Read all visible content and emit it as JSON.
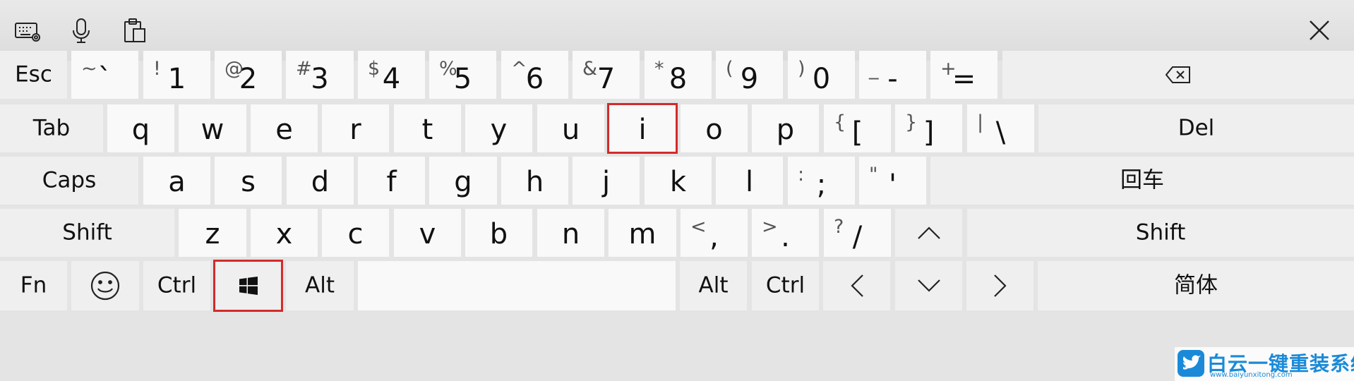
{
  "toolbar": {
    "icons": [
      "keyboard-settings-icon",
      "microphone-icon",
      "clipboard-icon",
      "close-icon"
    ]
  },
  "rows": [
    [
      {
        "name": "esc",
        "label": "Esc",
        "func": true
      },
      {
        "name": "backtick",
        "main": "`",
        "sec": "~"
      },
      {
        "name": "1",
        "main": "1",
        "sec": "!"
      },
      {
        "name": "2",
        "main": "2",
        "sec": "@"
      },
      {
        "name": "3",
        "main": "3",
        "sec": "#"
      },
      {
        "name": "4",
        "main": "4",
        "sec": "$"
      },
      {
        "name": "5",
        "main": "5",
        "sec": "%"
      },
      {
        "name": "6",
        "main": "6",
        "sec": "^"
      },
      {
        "name": "7",
        "main": "7",
        "sec": "&"
      },
      {
        "name": "8",
        "main": "8",
        "sec": "*"
      },
      {
        "name": "9",
        "main": "9",
        "sec": "("
      },
      {
        "name": "0",
        "main": "0",
        "sec": ")"
      },
      {
        "name": "minus",
        "main": "-",
        "sec": "_"
      },
      {
        "name": "equals",
        "main": "=",
        "sec": "+"
      },
      {
        "name": "backspace",
        "icon": "backspace-icon",
        "func": true
      }
    ],
    [
      {
        "name": "tab",
        "label": "Tab",
        "func": true
      },
      {
        "name": "q",
        "main": "q"
      },
      {
        "name": "w",
        "main": "w"
      },
      {
        "name": "e",
        "main": "e"
      },
      {
        "name": "r",
        "main": "r"
      },
      {
        "name": "t",
        "main": "t"
      },
      {
        "name": "y",
        "main": "y"
      },
      {
        "name": "u",
        "main": "u"
      },
      {
        "name": "i",
        "main": "i"
      },
      {
        "name": "o",
        "main": "o"
      },
      {
        "name": "p",
        "main": "p"
      },
      {
        "name": "left-bracket",
        "main": "[",
        "sec": "{"
      },
      {
        "name": "right-bracket",
        "main": "]",
        "sec": "}"
      },
      {
        "name": "backslash",
        "main": "\\",
        "sec": "|"
      },
      {
        "name": "del",
        "label": "Del",
        "func": true
      }
    ],
    [
      {
        "name": "caps",
        "label": "Caps",
        "func": true
      },
      {
        "name": "a",
        "main": "a"
      },
      {
        "name": "s",
        "main": "s"
      },
      {
        "name": "d",
        "main": "d"
      },
      {
        "name": "f",
        "main": "f"
      },
      {
        "name": "g",
        "main": "g"
      },
      {
        "name": "h",
        "main": "h"
      },
      {
        "name": "j",
        "main": "j"
      },
      {
        "name": "k",
        "main": "k"
      },
      {
        "name": "l",
        "main": "l"
      },
      {
        "name": "semicolon",
        "main": ";",
        "sec": ":"
      },
      {
        "name": "quote",
        "main": "'",
        "sec": "\""
      },
      {
        "name": "enter",
        "label": "回车",
        "func": true
      }
    ],
    [
      {
        "name": "shift-left",
        "label": "Shift",
        "func": true
      },
      {
        "name": "z",
        "main": "z"
      },
      {
        "name": "x",
        "main": "x"
      },
      {
        "name": "c",
        "main": "c"
      },
      {
        "name": "v",
        "main": "v"
      },
      {
        "name": "b",
        "main": "b"
      },
      {
        "name": "n",
        "main": "n"
      },
      {
        "name": "m",
        "main": "m"
      },
      {
        "name": "comma",
        "main": ",",
        "sec": "<"
      },
      {
        "name": "period",
        "main": ".",
        "sec": ">"
      },
      {
        "name": "slash",
        "main": "/",
        "sec": "?"
      },
      {
        "name": "up",
        "icon": "arrow-up-icon",
        "func": true
      },
      {
        "name": "shift-right",
        "label": "Shift",
        "func": true
      }
    ],
    [
      {
        "name": "fn",
        "label": "Fn",
        "func": true
      },
      {
        "name": "emoji",
        "icon": "emoji-icon",
        "func": true
      },
      {
        "name": "ctrl-left",
        "label": "Ctrl",
        "func": true
      },
      {
        "name": "windows",
        "icon": "windows-icon",
        "func": true
      },
      {
        "name": "alt-left",
        "label": "Alt",
        "func": true
      },
      {
        "name": "space"
      },
      {
        "name": "alt-right",
        "label": "Alt",
        "func": true
      },
      {
        "name": "ctrl-right",
        "label": "Ctrl",
        "func": true
      },
      {
        "name": "left",
        "icon": "arrow-left-icon",
        "func": true
      },
      {
        "name": "down",
        "icon": "arrow-down-icon",
        "func": true
      },
      {
        "name": "right",
        "icon": "arrow-right-icon",
        "func": true
      },
      {
        "name": "lang",
        "label": "简体",
        "func": true
      }
    ]
  ],
  "highlights": [
    "i",
    "windows"
  ],
  "watermark": {
    "text": "白云一键重装系统",
    "url": "www.baiyunxitong.com"
  },
  "colors": {
    "highlight": "#d32b2b",
    "watermark": "#1a8ad8"
  }
}
